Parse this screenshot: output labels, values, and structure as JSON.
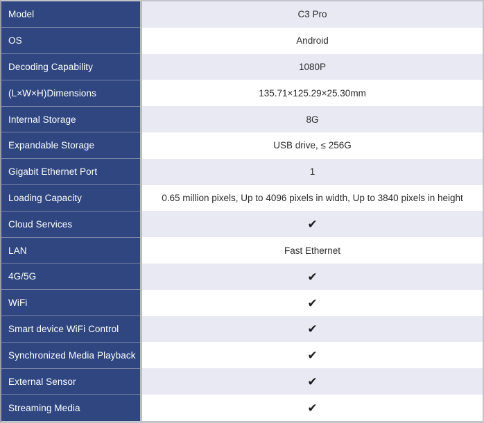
{
  "table": {
    "check_symbol": "✔",
    "colors": {
      "label_background": "#2f4680",
      "label_text": "#ffffff",
      "row_alt_background": "#e9e9f3",
      "row_background": "#ffffff",
      "outer_border": "#c2c3cb",
      "label_divider": "#7a85a6",
      "column_divider": "#b9bac4",
      "value_text": "#2b2b2b"
    },
    "rows": [
      {
        "label": "Model",
        "value": "C3 Pro",
        "type": "text"
      },
      {
        "label": "OS",
        "value": "Android",
        "type": "text"
      },
      {
        "label": "Decoding Capability",
        "value": "1080P",
        "type": "text"
      },
      {
        "label": "(L×W×H)Dimensions",
        "value": "135.71×125.29×25.30mm",
        "type": "text"
      },
      {
        "label": "Internal Storage",
        "value": "8G",
        "type": "text"
      },
      {
        "label": "Expandable Storage",
        "value": "USB drive, ≤ 256G",
        "type": "text"
      },
      {
        "label": "Gigabit Ethernet Port",
        "value": "1",
        "type": "text"
      },
      {
        "label": "Loading Capacity",
        "value": "0.65 million pixels, Up to 4096 pixels in width, Up to 3840 pixels in height",
        "type": "text"
      },
      {
        "label": "Cloud Services",
        "value": "✔",
        "type": "check"
      },
      {
        "label": "LAN",
        "value": "Fast Ethernet",
        "type": "text"
      },
      {
        "label": "4G/5G",
        "value": "✔",
        "type": "check"
      },
      {
        "label": "WiFi",
        "value": "✔",
        "type": "check"
      },
      {
        "label": "Smart device WiFi Control",
        "value": "✔",
        "type": "check"
      },
      {
        "label": "Synchronized Media Playback",
        "value": "✔",
        "type": "check"
      },
      {
        "label": "External Sensor",
        "value": "✔",
        "type": "check"
      },
      {
        "label": "Streaming Media",
        "value": "✔",
        "type": "check"
      }
    ]
  }
}
